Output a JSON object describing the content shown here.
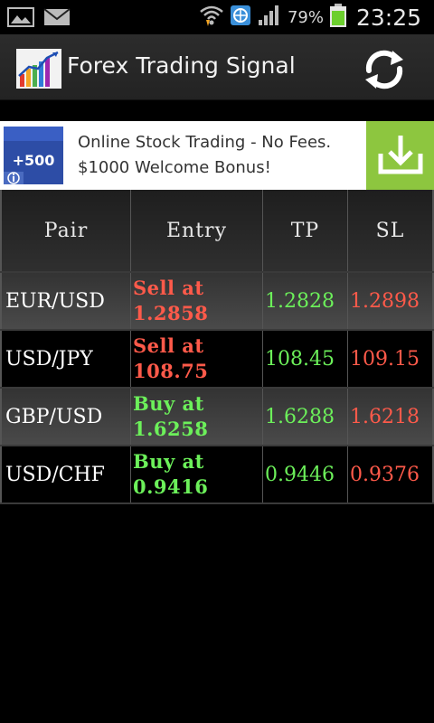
{
  "status_bar": {
    "battery_percent": "79%",
    "time": "23:25",
    "battery_level": 0.79
  },
  "header": {
    "title": "Forex Trading Signal"
  },
  "ad": {
    "line1": "Online Stock Trading - No Fees.",
    "line2": "$1000 Welcome Bonus!",
    "badge": "+500"
  },
  "table": {
    "columns": [
      "Pair",
      "Entry",
      "TP",
      "SL"
    ],
    "rows": [
      {
        "pair": "EUR/USD",
        "entry_action": "Sell at",
        "entry_price": "1.2858",
        "tp": "1.2828",
        "sl": "1.2898",
        "side": "sell"
      },
      {
        "pair": "USD/JPY",
        "entry_action": "Sell at",
        "entry_price": "108.75",
        "tp": "108.45",
        "sl": "109.15",
        "side": "sell"
      },
      {
        "pair": "GBP/USD",
        "entry_action": "Buy at",
        "entry_price": "1.6258",
        "tp": "1.6288",
        "sl": "1.6218",
        "side": "buy"
      },
      {
        "pair": "USD/CHF",
        "entry_action": "Buy at",
        "entry_price": "0.9416",
        "tp": "0.9446",
        "sl": "0.9376",
        "side": "buy"
      }
    ]
  },
  "colors": {
    "sell": "#ff5a4a",
    "buy": "#6cf05a",
    "ad_download": "#8dc63f"
  }
}
